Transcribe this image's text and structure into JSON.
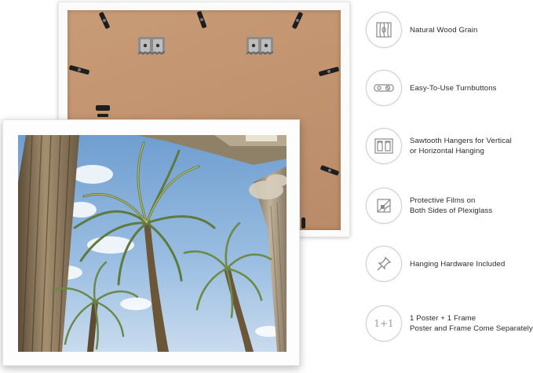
{
  "features": [
    {
      "icon": "wood-grain-icon",
      "lines": [
        "Natural Wood Grain"
      ]
    },
    {
      "icon": "turnbutton-icon",
      "lines": [
        "Easy-To-Use Turnbuttons"
      ]
    },
    {
      "icon": "sawtooth-hanger-icon",
      "lines": [
        "Sawtooth Hangers for Vertical",
        "or Horizontal Hanging"
      ]
    },
    {
      "icon": "protective-film-icon",
      "lines": [
        "Protective Films on",
        "Both Sides of Plexiglass"
      ]
    },
    {
      "icon": "push-pin-icon",
      "lines": [
        "Hanging Hardware Included"
      ]
    },
    {
      "icon": "one-plus-one-icon",
      "icon_text": "1+1",
      "lines": [
        "1 Poster + 1 Frame",
        "Poster and Frame Come Separately"
      ]
    }
  ],
  "colors": {
    "frame": "#fbfbfb",
    "backing": "#c29470",
    "sky": "#8fb4dc",
    "text": "#2b2b2b",
    "icon_stroke": "#8a8a8a"
  }
}
